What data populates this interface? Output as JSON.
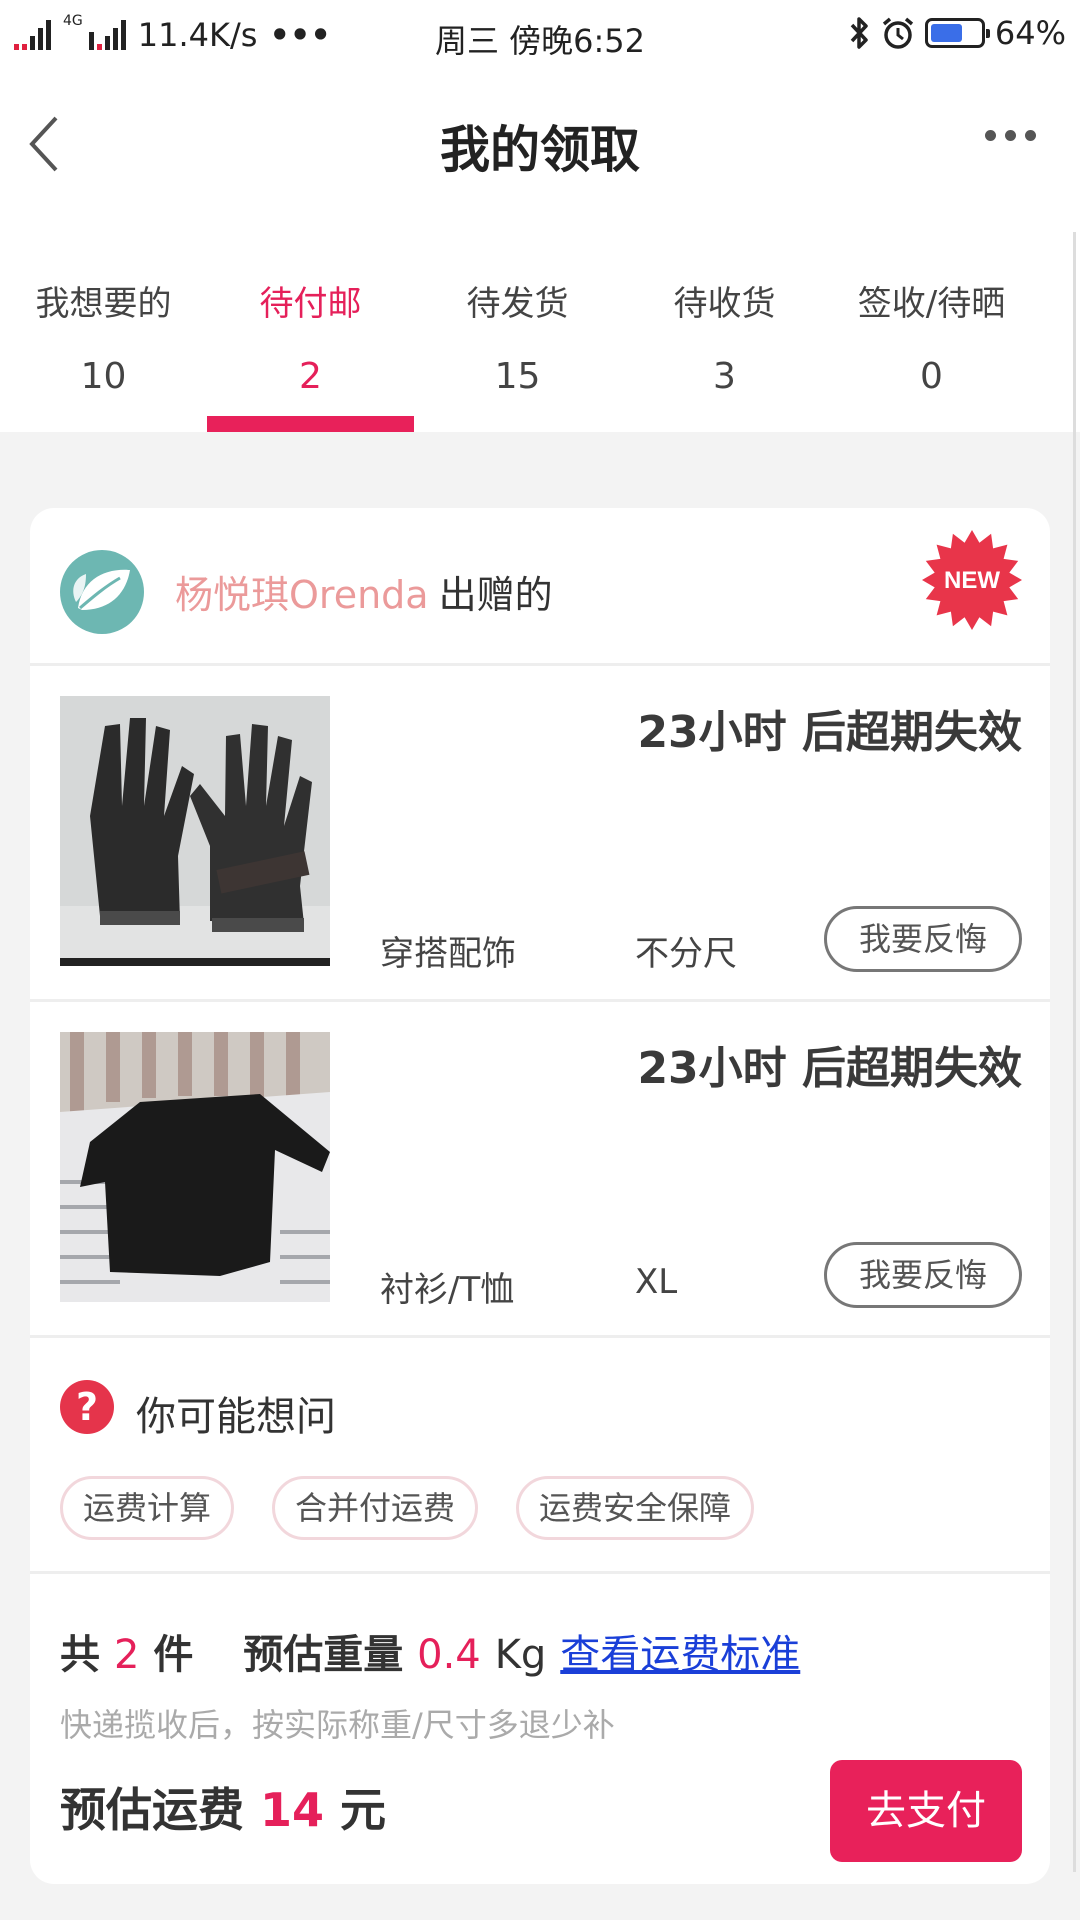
{
  "status_bar": {
    "net_type": "4G",
    "speed": "11.4K/s",
    "more": "•••",
    "time": "周三 傍晚6:52",
    "battery": "64%",
    "battery_level": 0.64,
    "icons": [
      "signal-icon",
      "bluetooth-icon",
      "alarm-icon",
      "battery-icon"
    ]
  },
  "header": {
    "title": "我的领取",
    "back_icon": "chevron-left-icon",
    "more_icon": "more-dots-icon"
  },
  "tabs": [
    {
      "label": "我想要的",
      "count": "10",
      "active": false
    },
    {
      "label": "待付邮",
      "count": "2",
      "active": true
    },
    {
      "label": "待发货",
      "count": "15",
      "active": false
    },
    {
      "label": "待收货",
      "count": "3",
      "active": false
    },
    {
      "label": "签收/待晒",
      "count": "0",
      "active": false
    }
  ],
  "card": {
    "giver_name": "杨悦琪Orenda",
    "giver_suffix": "出赠的",
    "badge": "NEW",
    "items": [
      {
        "expire": "23小时 后超期失效",
        "category": "穿搭配饰",
        "size": "不分尺",
        "action": "我要反悔",
        "image": "gloves-photo"
      },
      {
        "expire": "23小时 后超期失效",
        "category": "衬衫/T恤",
        "size": "XL",
        "action": "我要反悔",
        "image": "black-shirt-photo"
      }
    ],
    "faq": {
      "title": "你可能想问",
      "icon": "?",
      "chips": [
        "运费计算",
        "合并付运费",
        "运费安全保障"
      ]
    },
    "summary": {
      "total_prefix": "共",
      "total_count": "2",
      "total_unit": "件",
      "weight_label": "预估重量",
      "weight_value": "0.4",
      "weight_unit": "Kg",
      "link": "查看运费标准",
      "note": "快递揽收后，按实际称重/尺寸多退少补",
      "fee_label": "预估运费",
      "fee_value": "14",
      "fee_unit": "元",
      "pay_button": "去支付"
    }
  },
  "colors": {
    "accent": "#e8215a",
    "giver_name": "#eb9a9a",
    "link": "#1a3fd8",
    "faq_icon": "#e5344b",
    "avatar_bg": "#6db7b2"
  }
}
